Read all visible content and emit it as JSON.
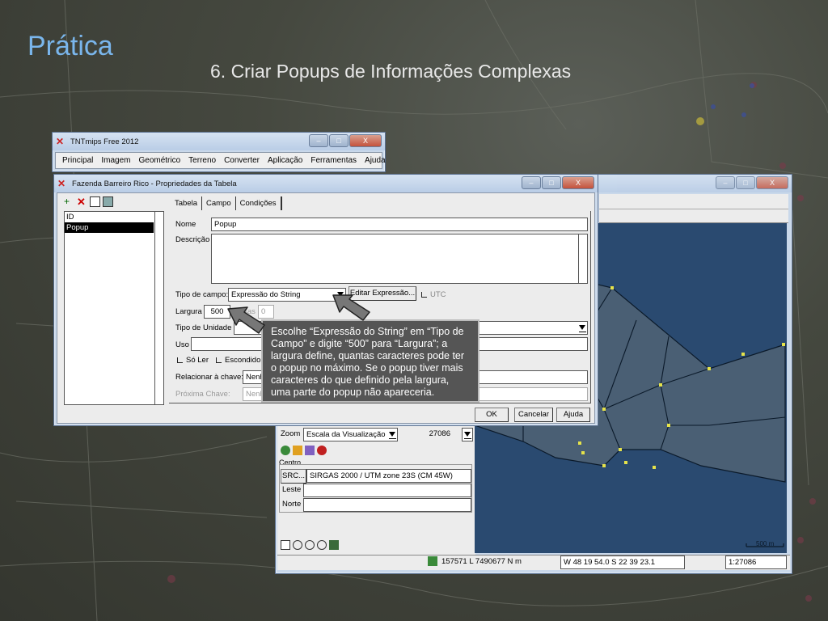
{
  "slide": {
    "title": "Prática",
    "subtitle": "6. Criar Popups de Informações Complexas"
  },
  "main_window": {
    "title": "TNTmips Free 2012",
    "menu": [
      "Principal",
      "Imagem",
      "Geométrico",
      "Terreno",
      "Converter",
      "Aplicação",
      "Ferramentas",
      "Ajuda"
    ]
  },
  "view_window": {
    "zoom_label": "Zoom",
    "zoom_mode": "Escala da Visualização",
    "zoom_value": "27086",
    "centro_label": "Centro",
    "src_button": "SRC...",
    "src_value": "SIRGAS 2000 / UTM zone 23S (CM 45W)",
    "leste_label": "Leste",
    "norte_label": "Norte",
    "status_coord_utm": "157571 L 7490677 N m",
    "status_coord_geo": "W 48 19 54.0  S 22 39 23.1",
    "status_scale": "1:27086",
    "scalebar_label": "500 m"
  },
  "props_window": {
    "title": "Fazenda Barreiro Rico - Propriedades da Tabela",
    "field_list": [
      "ID",
      "Popup"
    ],
    "selected_index": 1,
    "tabs": [
      "Tabela",
      "Campo",
      "Condições"
    ],
    "active_tab": "Campo",
    "nome_label": "Nome",
    "nome_value": "Popup",
    "descricao_label": "Descrição",
    "tipo_campo_label": "Tipo de campo:",
    "tipo_campo_value": "Expressão do String",
    "editar_expr_button": "Editar Expressão...",
    "utc_label": "UTC",
    "largura_label": "Largura",
    "largura_value": "500",
    "casas_label": "Casas",
    "casas_value": "0",
    "tipo_unidade_label": "Tipo de Unidade",
    "uso_label": "Uso",
    "so_ler_label": "Só Ler",
    "escondido_label": "Escondido",
    "relacionar_label": "Relacionar à chave:",
    "relacionar_value": "Nenh",
    "proxima_label": "Próxima Chave:",
    "proxima_value": "Nenh",
    "ok_button": "OK",
    "cancel_button": "Cancelar",
    "help_button": "Ajuda"
  },
  "callout_text": "Escolhe “Expressão do String” em “Tipo de Campo” e digite “500” para “Largura”; a largura define, quantas caracteres pode ter o popup no máximo. Se o popup tiver mais caracteres do que definido pela largura, uma parte do popup não apareceria.",
  "colors": {
    "title_blue": "#7ab6ec",
    "map_water": "#2a4a70",
    "map_nodes": "#e6e34a",
    "callout_bg": "#555555"
  }
}
